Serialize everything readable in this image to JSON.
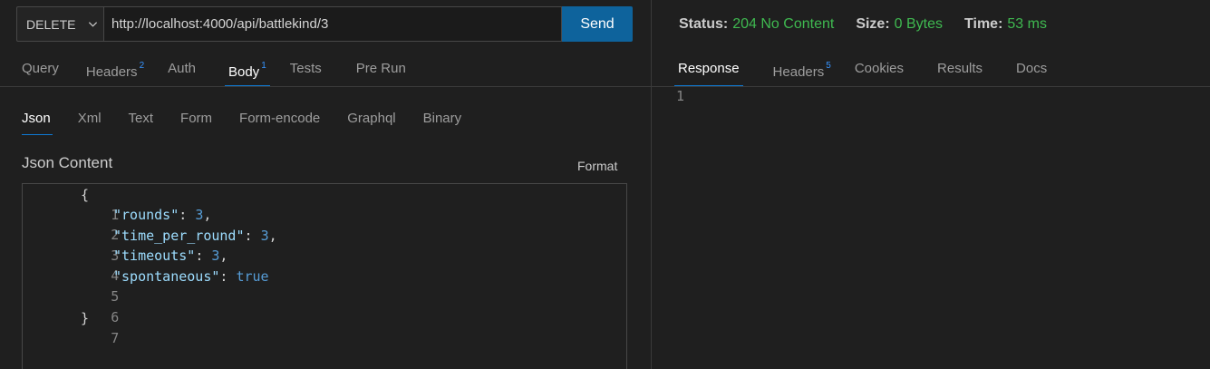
{
  "request": {
    "method": "DELETE",
    "url": "http://localhost:4000/api/battlekind/3",
    "send_label": "Send",
    "tabs": [
      {
        "label": "Query",
        "badge": ""
      },
      {
        "label": "Headers",
        "badge": "2"
      },
      {
        "label": "Auth",
        "badge": ""
      },
      {
        "label": "Body",
        "badge": "1"
      },
      {
        "label": "Tests",
        "badge": ""
      },
      {
        "label": "Pre Run",
        "badge": ""
      }
    ],
    "active_tab": "Body",
    "body_tabs": [
      "Json",
      "Xml",
      "Text",
      "Form",
      "Form-encode",
      "Graphql",
      "Binary"
    ],
    "active_body_tab": "Json",
    "content_title": "Json Content",
    "format_label": "Format",
    "json_lines": [
      {
        "num": "1",
        "text": "{"
      },
      {
        "num": "2",
        "key": "\"rounds\"",
        "value": "3",
        "suffix": ","
      },
      {
        "num": "3",
        "key": "\"time_per_round\"",
        "value": "3",
        "suffix": ","
      },
      {
        "num": "4",
        "key": "\"timeouts\"",
        "value": "3",
        "suffix": ","
      },
      {
        "num": "5",
        "key": "\"spontaneous\"",
        "value": "true",
        "suffix": ""
      },
      {
        "num": "6",
        "text": ""
      },
      {
        "num": "7",
        "text": "}"
      }
    ]
  },
  "response": {
    "status_label": "Status:",
    "status_value": "204 No Content",
    "size_label": "Size:",
    "size_value": "0 Bytes",
    "time_label": "Time:",
    "time_value": "53 ms",
    "tabs": [
      {
        "label": "Response",
        "badge": ""
      },
      {
        "label": "Headers",
        "badge": "5"
      },
      {
        "label": "Cookies",
        "badge": ""
      },
      {
        "label": "Results",
        "badge": ""
      },
      {
        "label": "Docs",
        "badge": ""
      }
    ],
    "active_tab": "Response",
    "body_line_number": "1"
  },
  "colors": {
    "accent": "#0e639c",
    "status_ok": "#3fb950",
    "tab_underline": "#0e7ad4"
  }
}
